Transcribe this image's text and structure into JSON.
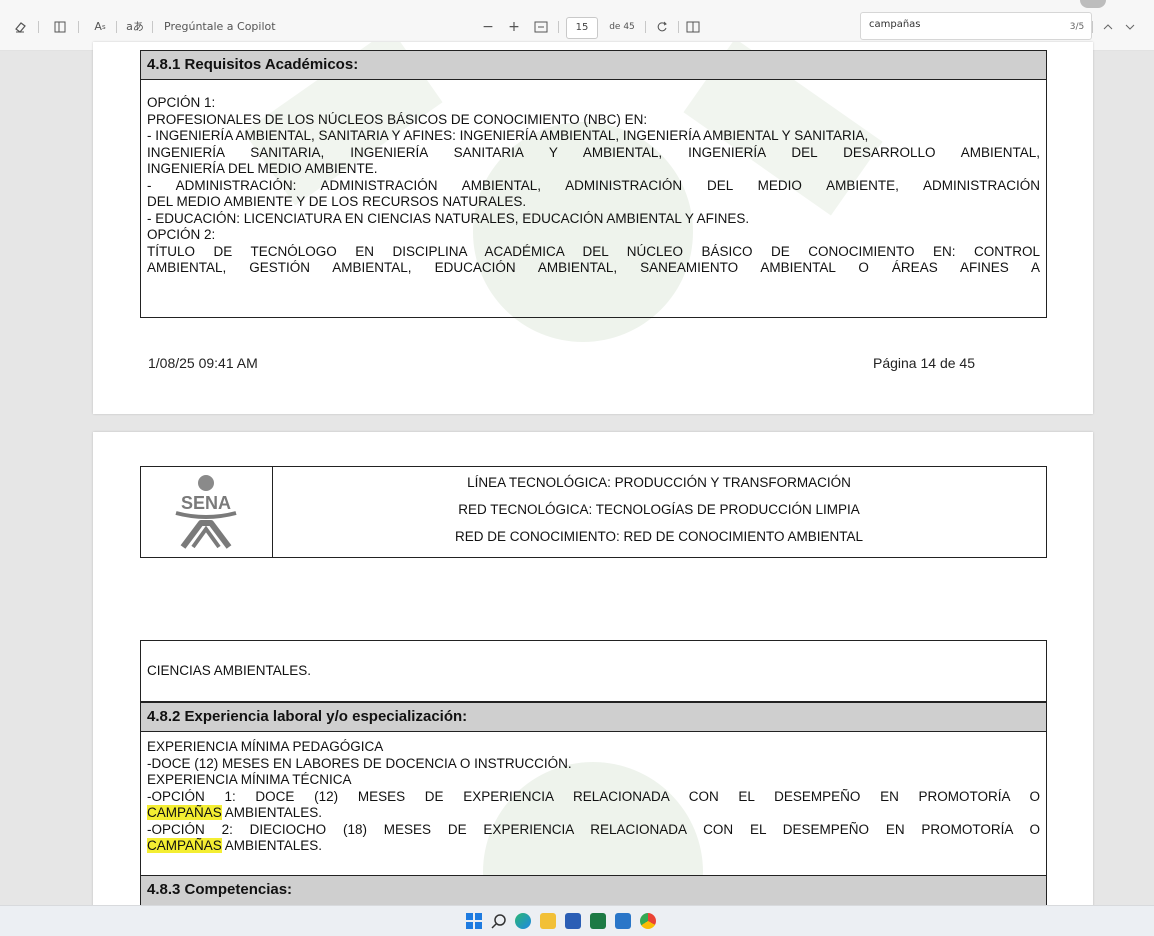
{
  "toolbar": {
    "copilot_label": "Pregúntale a Copilot",
    "minus": "−",
    "plus": "+",
    "page_current": "15",
    "page_total": "de 45",
    "search_value": "campañas",
    "search_count": "3/5",
    "font_icon": "A",
    "translate_icon": "aあ"
  },
  "page1": {
    "section_title": "4.8.1 Requisitos Académicos:",
    "lines": [
      "OPCIÓN 1:",
      "PROFESIONALES DE LOS NÚCLEOS BÁSICOS DE CONOCIMIENTO (NBC) EN:",
      "- INGENIERÍA AMBIENTAL, SANITARIA Y AFINES: INGENIERÍA AMBIENTAL, INGENIERÍA AMBIENTAL Y SANITARIA,",
      "INGENIERÍA SANITARIA, INGENIERÍA SANITARIA Y AMBIENTAL, INGENIERÍA DEL DESARROLLO AMBIENTAL,",
      "INGENIERÍA DEL MEDIO AMBIENTE.",
      "- ADMINISTRACIÓN: ADMINISTRACIÓN AMBIENTAL, ADMINISTRACIÓN DEL MEDIO AMBIENTE, ADMINISTRACIÓN",
      "DEL MEDIO AMBIENTE Y DE LOS RECURSOS NATURALES.",
      "- EDUCACIÓN:  LICENCIATURA EN CIENCIAS NATURALES, EDUCACIÓN AMBIENTAL Y AFINES.",
      "OPCIÓN 2:",
      "TÍTULO DE TECNÓLOGO EN DISCIPLINA ACADÉMICA DEL NÚCLEO BÁSICO DE CONOCIMIENTO EN: CONTROL",
      "AMBIENTAL, GESTIÓN AMBIENTAL, EDUCACIÓN AMBIENTAL, SANEAMIENTO AMBIENTAL O ÁREAS AFINES A"
    ],
    "footer_date": "1/08/25 09:41 AM",
    "footer_page": "Página 14 de 45"
  },
  "page2": {
    "logo_text": "SENA",
    "header_lines": [
      "LÍNEA TECNOLÓGICA: PRODUCCIÓN Y TRANSFORMACIÓN",
      "RED TECNOLÓGICA: TECNOLOGÍAS  DE PRODUCCIÓN LIMPIA",
      "RED DE CONOCIMIENTO: RED DE CONOCIMIENTO AMBIENTAL"
    ],
    "continuation": "CIENCIAS AMBIENTALES.",
    "section2_title": "4.8.2 Experiencia laboral y/o especialización:",
    "exp_lines": [
      "EXPERIENCIA MÍNIMA PEDAGÓGICA",
      "-DOCE (12) MESES EN LABORES DE DOCENCIA O INSTRUCCIÓN.",
      "EXPERIENCIA MÍNIMA TÉCNICA",
      "-OPCIÓN 1: DOCE (12) MESES DE EXPERIENCIA RELACIONADA CON EL DESEMPEÑO EN PROMOTORÍA O",
      "-OPCIÓN 2: DIECIOCHO (18) MESES DE EXPERIENCIA RELACIONADA CON EL DESEMPEÑO EN PROMOTORÍA O"
    ],
    "highlight_word": "CAMPAÑAS",
    "after_highlight": " AMBIENTALES.",
    "section3_title": "4.8.3 Competencias:"
  },
  "colors": {
    "highlight": "#f4ee32",
    "header_gray": "#cfcfcf"
  }
}
